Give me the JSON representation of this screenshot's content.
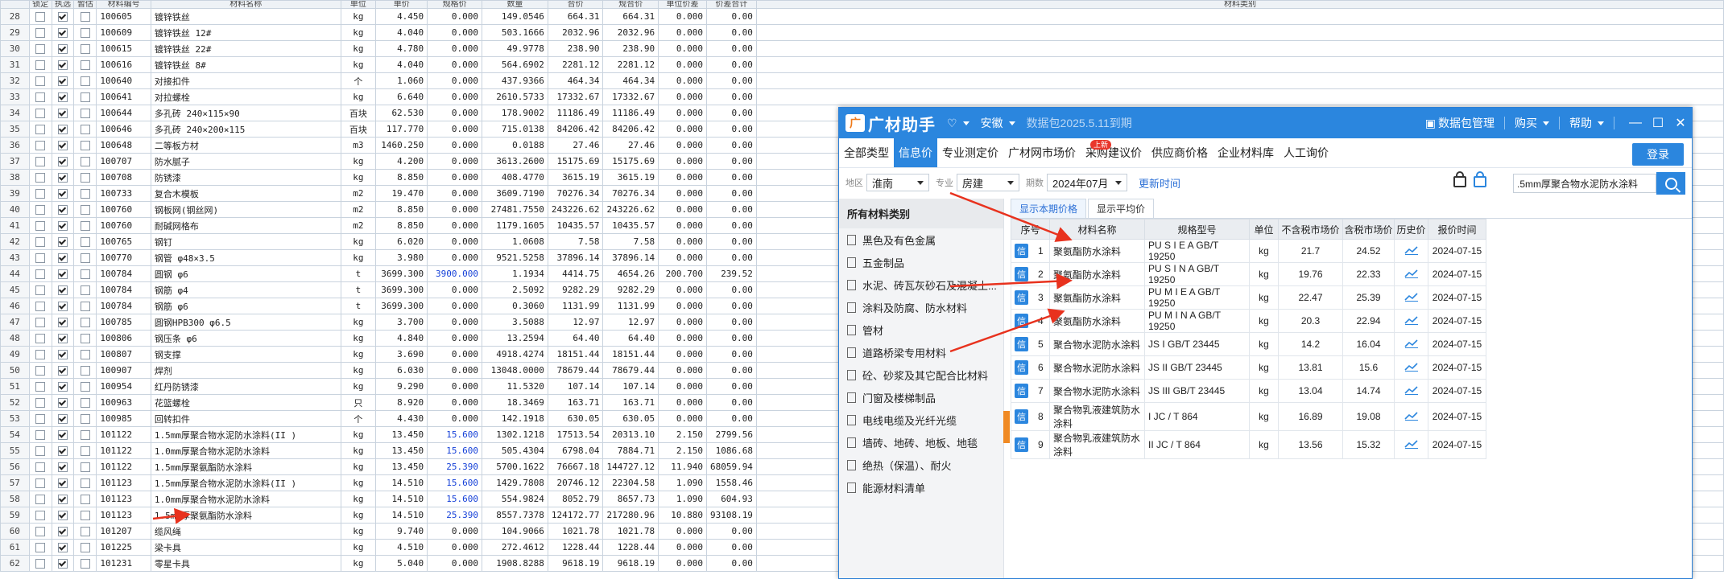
{
  "sheet": {
    "headers": [
      "",
      "锁定",
      "执选",
      "暂估",
      "材料编号",
      "材料名称",
      "单位",
      "单价",
      "规格价",
      "数量",
      "合价",
      "规合价",
      "单位价差",
      "价差合计",
      "材料类别"
    ],
    "rows": [
      [
        "28",
        false,
        true,
        false,
        "100605",
        "镀锌铁丝",
        "kg",
        "4.450",
        "0.000",
        "149.0546",
        "664.31",
        "664.31",
        "0.000",
        "0.00"
      ],
      [
        "29",
        false,
        true,
        false,
        "100609",
        "镀锌铁丝 12#",
        "kg",
        "4.040",
        "0.000",
        "503.1666",
        "2032.96",
        "2032.96",
        "0.000",
        "0.00"
      ],
      [
        "30",
        false,
        true,
        false,
        "100615",
        "镀锌铁丝 22#",
        "kg",
        "4.780",
        "0.000",
        "49.9778",
        "238.90",
        "238.90",
        "0.000",
        "0.00"
      ],
      [
        "31",
        false,
        true,
        false,
        "100616",
        "镀锌铁丝 8#",
        "kg",
        "4.040",
        "0.000",
        "564.6902",
        "2281.12",
        "2281.12",
        "0.000",
        "0.00"
      ],
      [
        "32",
        false,
        true,
        false,
        "100640",
        "对接扣件",
        "个",
        "1.060",
        "0.000",
        "437.9366",
        "464.34",
        "464.34",
        "0.000",
        "0.00"
      ],
      [
        "33",
        false,
        true,
        false,
        "100641",
        "对拉螺栓",
        "kg",
        "6.640",
        "0.000",
        "2610.5733",
        "17332.67",
        "17332.67",
        "0.000",
        "0.00"
      ],
      [
        "34",
        false,
        true,
        false,
        "100644",
        "多孔砖 240×115×90",
        "百块",
        "62.530",
        "0.000",
        "178.9002",
        "11186.49",
        "11186.49",
        "0.000",
        "0.00"
      ],
      [
        "35",
        false,
        true,
        false,
        "100646",
        "多孔砖 240×200×115",
        "百块",
        "117.770",
        "0.000",
        "715.0138",
        "84206.42",
        "84206.42",
        "0.000",
        "0.00"
      ],
      [
        "36",
        false,
        true,
        false,
        "100648",
        "二等板方材",
        "m3",
        "1460.250",
        "0.000",
        "0.0188",
        "27.46",
        "27.46",
        "0.000",
        "0.00"
      ],
      [
        "37",
        false,
        true,
        false,
        "100707",
        "防水腻子",
        "kg",
        "4.200",
        "0.000",
        "3613.2600",
        "15175.69",
        "15175.69",
        "0.000",
        "0.00"
      ],
      [
        "38",
        false,
        true,
        false,
        "100708",
        "防锈漆",
        "kg",
        "8.850",
        "0.000",
        "408.4770",
        "3615.19",
        "3615.19",
        "0.000",
        "0.00"
      ],
      [
        "39",
        false,
        true,
        false,
        "100733",
        "复合木模板",
        "m2",
        "19.470",
        "0.000",
        "3609.7190",
        "70276.34",
        "70276.34",
        "0.000",
        "0.00"
      ],
      [
        "40",
        false,
        true,
        false,
        "100760",
        "钢板网(钢丝网)",
        "m2",
        "8.850",
        "0.000",
        "27481.7550",
        "243226.62",
        "243226.62",
        "0.000",
        "0.00"
      ],
      [
        "41",
        false,
        true,
        false,
        "100760",
        "耐碱网格布",
        "m2",
        "8.850",
        "0.000",
        "1179.1605",
        "10435.57",
        "10435.57",
        "0.000",
        "0.00"
      ],
      [
        "42",
        false,
        true,
        false,
        "100765",
        "钢钉",
        "kg",
        "6.020",
        "0.000",
        "1.0608",
        "7.58",
        "7.58",
        "0.000",
        "0.00"
      ],
      [
        "43",
        false,
        true,
        false,
        "100770",
        "钢管 φ48×3.5",
        "kg",
        "3.980",
        "0.000",
        "9521.5258",
        "37896.14",
        "37896.14",
        "0.000",
        "0.00"
      ],
      [
        "44",
        false,
        true,
        false,
        "100784",
        "圆钢 φ6",
        "t",
        "3699.300",
        "3900.000",
        "1.1934",
        "4414.75",
        "4654.26",
        "200.700",
        "239.52"
      ],
      [
        "45",
        false,
        true,
        false,
        "100784",
        "钢筋 φ4",
        "t",
        "3699.300",
        "0.000",
        "2.5092",
        "9282.29",
        "9282.29",
        "0.000",
        "0.00"
      ],
      [
        "46",
        false,
        true,
        false,
        "100784",
        "钢筋 φ6",
        "t",
        "3699.300",
        "0.000",
        "0.3060",
        "1131.99",
        "1131.99",
        "0.000",
        "0.00"
      ],
      [
        "47",
        false,
        true,
        false,
        "100785",
        "圆钢HPB300 φ6.5",
        "kg",
        "3.700",
        "0.000",
        "3.5088",
        "12.97",
        "12.97",
        "0.000",
        "0.00"
      ],
      [
        "48",
        false,
        true,
        false,
        "100806",
        "钢压条 φ6",
        "kg",
        "4.840",
        "0.000",
        "13.2594",
        "64.40",
        "64.40",
        "0.000",
        "0.00"
      ],
      [
        "49",
        false,
        true,
        false,
        "100807",
        "钢支撑",
        "kg",
        "3.690",
        "0.000",
        "4918.4274",
        "18151.44",
        "18151.44",
        "0.000",
        "0.00"
      ],
      [
        "50",
        false,
        true,
        false,
        "100907",
        "焊剂",
        "kg",
        "6.030",
        "0.000",
        "13048.0000",
        "78679.44",
        "78679.44",
        "0.000",
        "0.00"
      ],
      [
        "51",
        false,
        true,
        false,
        "100954",
        "红丹防锈漆",
        "kg",
        "9.290",
        "0.000",
        "11.5320",
        "107.14",
        "107.14",
        "0.000",
        "0.00"
      ],
      [
        "52",
        false,
        true,
        false,
        "100963",
        "花篮螺栓",
        "只",
        "8.920",
        "0.000",
        "18.3469",
        "163.71",
        "163.71",
        "0.000",
        "0.00"
      ],
      [
        "53",
        false,
        true,
        false,
        "100985",
        "回转扣件",
        "个",
        "4.430",
        "0.000",
        "142.1918",
        "630.05",
        "630.05",
        "0.000",
        "0.00"
      ],
      [
        "54",
        false,
        true,
        false,
        "101122",
        " 1.5mm厚聚合物水泥防水涂料(II )",
        "kg",
        "13.450",
        "15.600",
        "1302.1218",
        "17513.54",
        "20313.10",
        "2.150",
        "2799.56"
      ],
      [
        "55",
        false,
        true,
        false,
        "101122",
        "1.0mm厚聚合物水泥防水涂料",
        "kg",
        "13.450",
        "15.600",
        "505.4304",
        "6798.04",
        "7884.71",
        "2.150",
        "1086.68"
      ],
      [
        "56",
        false,
        true,
        false,
        "101122",
        "1.5mm厚聚氨酯防水涂料",
        "kg",
        "13.450",
        "25.390",
        "5700.1622",
        "76667.18",
        "144727.12",
        "11.940",
        "68059.94"
      ],
      [
        "57",
        false,
        true,
        false,
        "101123",
        " 1.5mm厚聚合物水泥防水涂料(II )",
        "kg",
        "14.510",
        "15.600",
        "1429.7808",
        "20746.12",
        "22304.58",
        "1.090",
        "1558.46"
      ],
      [
        "58",
        false,
        true,
        false,
        "101123",
        "1.0mm厚聚合物水泥防水涂料",
        "kg",
        "14.510",
        "15.600",
        "554.9824",
        "8052.79",
        "8657.73",
        "1.090",
        "604.93"
      ],
      [
        "59",
        false,
        true,
        false,
        "101123",
        "1.5mm厚聚氨酯防水涂料",
        "kg",
        "14.510",
        "25.390",
        "8557.7378",
        "124172.77",
        "217280.96",
        "10.880",
        "93108.19"
      ],
      [
        "60",
        false,
        true,
        false,
        "101207",
        "缆风绳",
        "kg",
        "9.740",
        "0.000",
        "104.9066",
        "1021.78",
        "1021.78",
        "0.000",
        "0.00"
      ],
      [
        "61",
        false,
        true,
        false,
        "101225",
        "梁卡具",
        "kg",
        "4.510",
        "0.000",
        "272.4612",
        "1228.44",
        "1228.44",
        "0.000",
        "0.00"
      ],
      [
        "62",
        false,
        true,
        false,
        "101231",
        "零星卡具",
        "kg",
        "5.040",
        "0.000",
        "1908.8288",
        "9618.19",
        "9618.19",
        "0.000",
        "0.00"
      ]
    ]
  },
  "panel": {
    "logo_mark": "广",
    "app_name": "广材助手",
    "region_btn": "安徽",
    "package_info": "数据包2025.5.11到期",
    "package_mgmt": "数据包管理",
    "buy": "购买",
    "help": "帮助",
    "win_min": "—",
    "win_max": "☐",
    "win_close": "✕",
    "nav": [
      "全部类型",
      "信息价",
      "专业测定价",
      "广材网市场价",
      "采购建议价",
      "供应商价格",
      "企业材料库",
      "人工询价"
    ],
    "nav_badge": "上新",
    "login": "登录",
    "filter": {
      "region_label": "地区",
      "region": "淮南",
      "major_label": "专业",
      "major": "房建",
      "period_label": "期数",
      "period": "2024年07月",
      "update": "更新时间",
      "search_value": ".5mm厚聚合物水泥防水涂料"
    },
    "sidebar_title": "所有材料类别",
    "categories": [
      "黑色及有色金属",
      "五金制品",
      "水泥、砖瓦灰砂石及混凝土...",
      "涂料及防腐、防水材料",
      "管材",
      "道路桥梁专用材料",
      "砼、砂浆及其它配合比材料",
      "门窗及楼梯制品",
      "电线电缆及光纤光缆",
      "墙砖、地砖、地板、地毯",
      "绝热（保温）、耐火",
      "能源材料清单"
    ],
    "subtabs": [
      "显示本期价格",
      "显示平均价"
    ],
    "grid_headers": [
      "序号",
      "材料名称",
      "规格型号",
      "单位",
      "不含税市场价",
      "含税市场价",
      "历史价",
      "报价时间"
    ],
    "tag": "信",
    "rows": [
      [
        "1",
        "聚氨酯防水涂料",
        "PU S I E A GB/T 19250",
        "kg",
        "21.7",
        "24.52",
        "2024-07-15"
      ],
      [
        "2",
        "聚氨酯防水涂料",
        "PU S I N A GB/T 19250",
        "kg",
        "19.76",
        "22.33",
        "2024-07-15"
      ],
      [
        "3",
        "聚氨酯防水涂料",
        "PU M I E A GB/T 19250",
        "kg",
        "22.47",
        "25.39",
        "2024-07-15"
      ],
      [
        "4",
        "聚氨酯防水涂料",
        "PU M I N A GB/T 19250",
        "kg",
        "20.3",
        "22.94",
        "2024-07-15"
      ],
      [
        "5",
        "聚合物水泥防水涂料",
        "JS I GB/T 23445",
        "kg",
        "14.2",
        "16.04",
        "2024-07-15"
      ],
      [
        "6",
        "聚合物水泥防水涂料",
        "JS II GB/T 23445",
        "kg",
        "13.81",
        "15.6",
        "2024-07-15"
      ],
      [
        "7",
        "聚合物水泥防水涂料",
        "JS III GB/T 23445",
        "kg",
        "13.04",
        "14.74",
        "2024-07-15"
      ],
      [
        "8",
        "聚合物乳液建筑防水涂料",
        "I JC / T 864",
        "kg",
        "16.89",
        "19.08",
        "2024-07-15"
      ],
      [
        "9",
        "聚合物乳液建筑防水涂料",
        "II JC / T 864",
        "kg",
        "13.56",
        "15.32",
        "2024-07-15"
      ]
    ]
  }
}
